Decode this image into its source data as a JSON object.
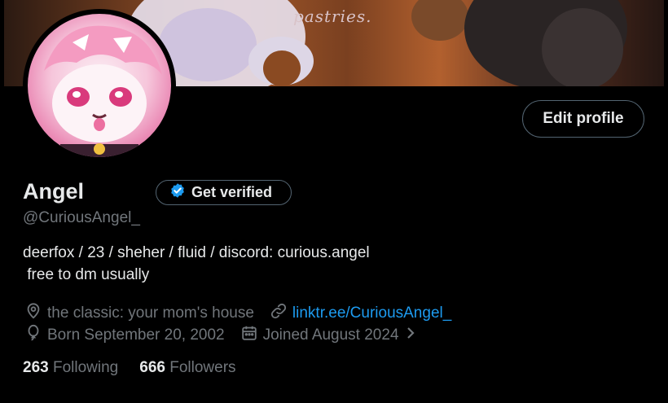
{
  "banner": {
    "text": "pastries."
  },
  "profile": {
    "name": "Angel",
    "verify_label": "Get verified",
    "handle": "@CuriousAngel_",
    "edit_label": "Edit profile",
    "bio_line1": "deerfox / 23 / sheher / fluid / discord: curious.angel",
    "bio_line2": " free to dm usually",
    "location": "the classic: your mom's house",
    "website": "linktr.ee/CuriousAngel_",
    "birthday": "Born September 20, 2002",
    "joined": "Joined August 2024",
    "following_count": "263",
    "following_label": "Following",
    "followers_count": "666",
    "followers_label": "Followers"
  },
  "colors": {
    "background": "#000000",
    "text_primary": "#e7e9ea",
    "text_secondary": "#71767b",
    "link": "#1d9bf0",
    "verified_badge": "#1d9bf0",
    "border": "#536471"
  },
  "icons": [
    "location-icon",
    "link-icon",
    "balloon-icon",
    "calendar-icon",
    "chevron-right-icon",
    "verified-badge-icon"
  ]
}
